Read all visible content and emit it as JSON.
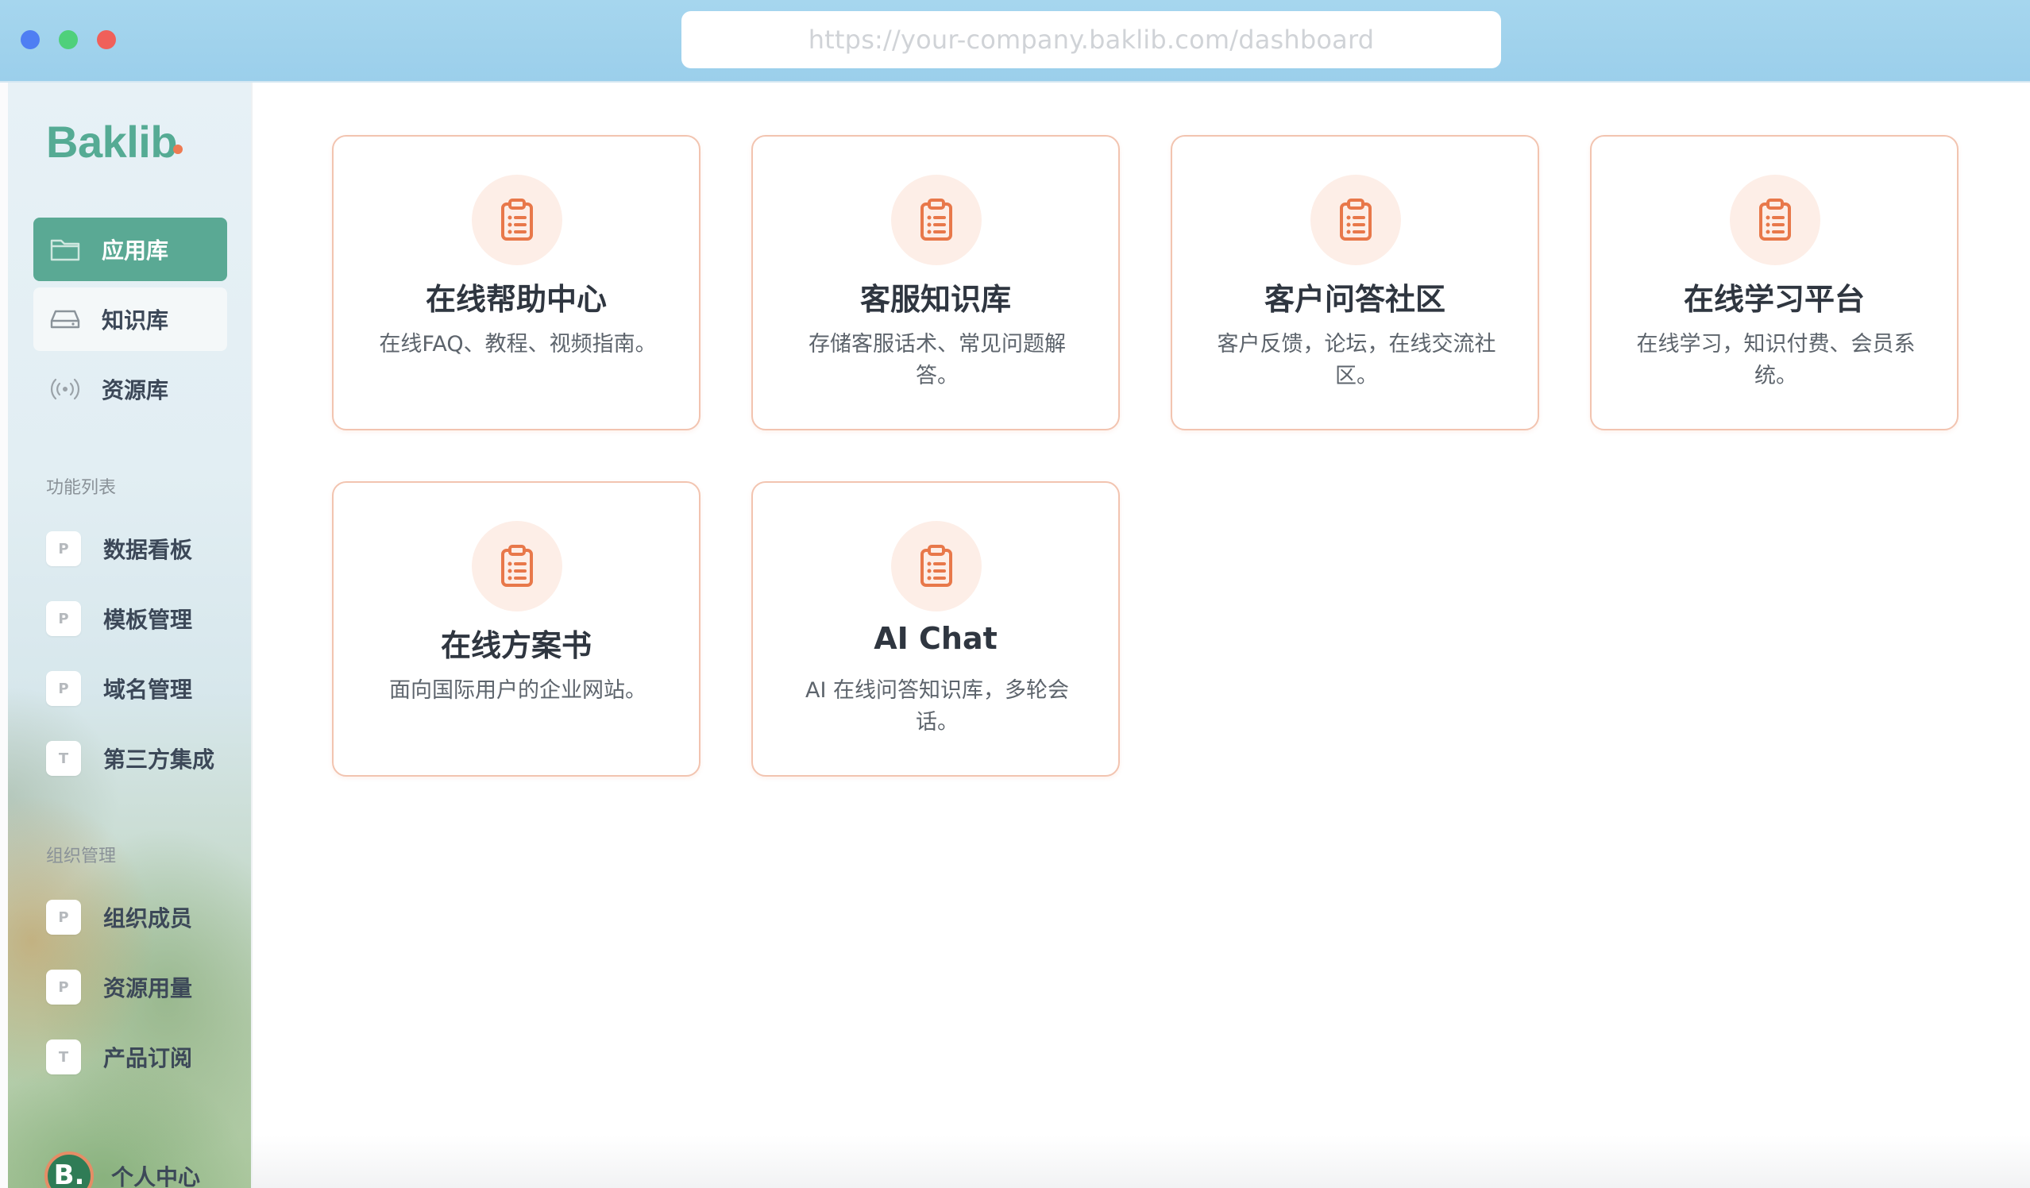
{
  "browser": {
    "url": "https://your-company.baklib.com/dashboard"
  },
  "sidebar": {
    "logo": "Baklib",
    "nav": [
      {
        "label": "应用库",
        "icon": "folder-icon"
      },
      {
        "label": "知识库",
        "icon": "drive-icon"
      },
      {
        "label": "资源库",
        "icon": "broadcast-icon"
      }
    ],
    "features_title": "功能列表",
    "features": [
      {
        "badge": "P",
        "label": "数据看板"
      },
      {
        "badge": "P",
        "label": "模板管理"
      },
      {
        "badge": "P",
        "label": "域名管理"
      },
      {
        "badge": "T",
        "label": "第三方集成"
      }
    ],
    "org_title": "组织管理",
    "org": [
      {
        "badge": "P",
        "label": "组织成员"
      },
      {
        "badge": "P",
        "label": "资源用量"
      },
      {
        "badge": "T",
        "label": "产品订阅"
      }
    ],
    "profile": {
      "avatar": "B.",
      "label": "个人中心"
    }
  },
  "main": {
    "cards": [
      {
        "title": "在线帮助中心",
        "desc": "在线FAQ、教程、视频指南。"
      },
      {
        "title": "客服知识库",
        "desc": "存储客服话术、常见问题解答。"
      },
      {
        "title": "客户问答社区",
        "desc": "客户反馈，论坛，在线交流社区。"
      },
      {
        "title": "在线学习平台",
        "desc": "在线学习，知识付费、会员系统。"
      },
      {
        "title": "在线方案书",
        "desc": "面向国际用户的企业网站。"
      },
      {
        "title": "AI Chat",
        "desc": "AI 在线问答知识库，多轮会话。"
      }
    ]
  },
  "colors": {
    "accent": "#5aa994",
    "card_border": "#f2c4b0",
    "icon_orange": "#e8784a",
    "icon_bg": "#fdeee7"
  }
}
